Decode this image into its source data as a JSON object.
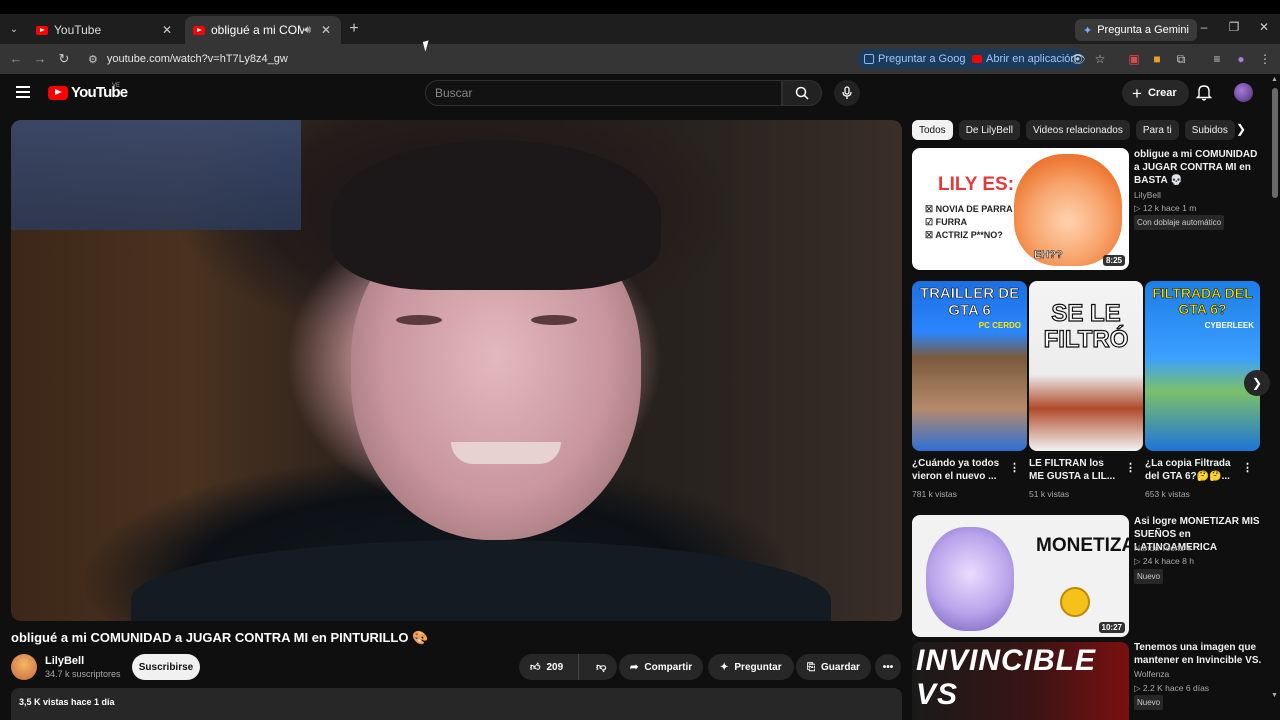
{
  "browser": {
    "tabs": [
      {
        "title": "YouTube"
      },
      {
        "title": "obligué a mi COMUNIDAD"
      }
    ],
    "gemini_label": "Pregunta a Gemini",
    "url": "youtube.com/watch?v=hT7Ly8z4_gw",
    "chip_google": "Preguntar a Google",
    "chip_app": "Abrir en aplicación"
  },
  "masthead": {
    "logo_text": "YouTube",
    "country_code": "VE",
    "search_placeholder": "Buscar",
    "create_label": "Crear"
  },
  "video": {
    "title": "obligué a mi COMUNIDAD a JUGAR CONTRA MI en PINTURILLO 🎨",
    "channel_name": "LilyBell",
    "subscribers": "34.7 k suscriptores",
    "subscribe_label": "Suscribirse",
    "likes": "209",
    "share_label": "Compartir",
    "ask_label": "Preguntar",
    "save_label": "Guardar",
    "description_meta": "3,5 K vistas  hace 1 día"
  },
  "filter_chips": [
    "Todos",
    "De LilyBell",
    "Videos relacionados",
    "Para ti",
    "Subidos"
  ],
  "recommendations": [
    {
      "title": "obligue a mi COMUNIDAD a JUGAR CONTRA MI en BASTA 💀",
      "channel": "LilyBell",
      "meta": "▷ 12 k   hace 1 m",
      "badge": "Con doblaje automático",
      "duration": "8:25",
      "thumb_big": "LILY ES:",
      "thumb_lines": [
        "☒ NOVIA DE PARRA",
        "☑ FURRA",
        "☒ ACTRIZ P**NO?"
      ],
      "thumb_tag": "EH??"
    },
    {
      "title": "Asi logre MONETIZAR MIS SUEÑOS en LATINOAMERICA",
      "channel": "Nanda Toons",
      "meta": "▷ 24 k   hace 8 h",
      "badge": "Nuevo",
      "duration": "10:27",
      "thumb_text": "MONETIZA"
    },
    {
      "title": "Tenemos una imagen que mantener en Invincible VS.",
      "channel": "Wolfenza",
      "meta": "▷ 2.2 K   hace 6 días",
      "badge": "Nuevo",
      "thumb_text": "INVINCIBLE VS"
    }
  ],
  "shorts": [
    {
      "caption": "TRAILLER DE GTA 6",
      "sub": "PC CERDO",
      "title": "¿Cuándo ya todos vieron el nuevo ...",
      "views": "781 k vistas"
    },
    {
      "caption": "SE LE FILTRÓ",
      "sub": "",
      "title": "LE FILTRAN los ME GUSTA a LIL...",
      "views": "51 k vistas"
    },
    {
      "caption": "FILTRADA DEL GTA 6?",
      "sub": "CYBERLEEK",
      "title": "¿La copia Filtrada del GTA 6?🤔🤔...",
      "views": "653 k vistas"
    }
  ]
}
